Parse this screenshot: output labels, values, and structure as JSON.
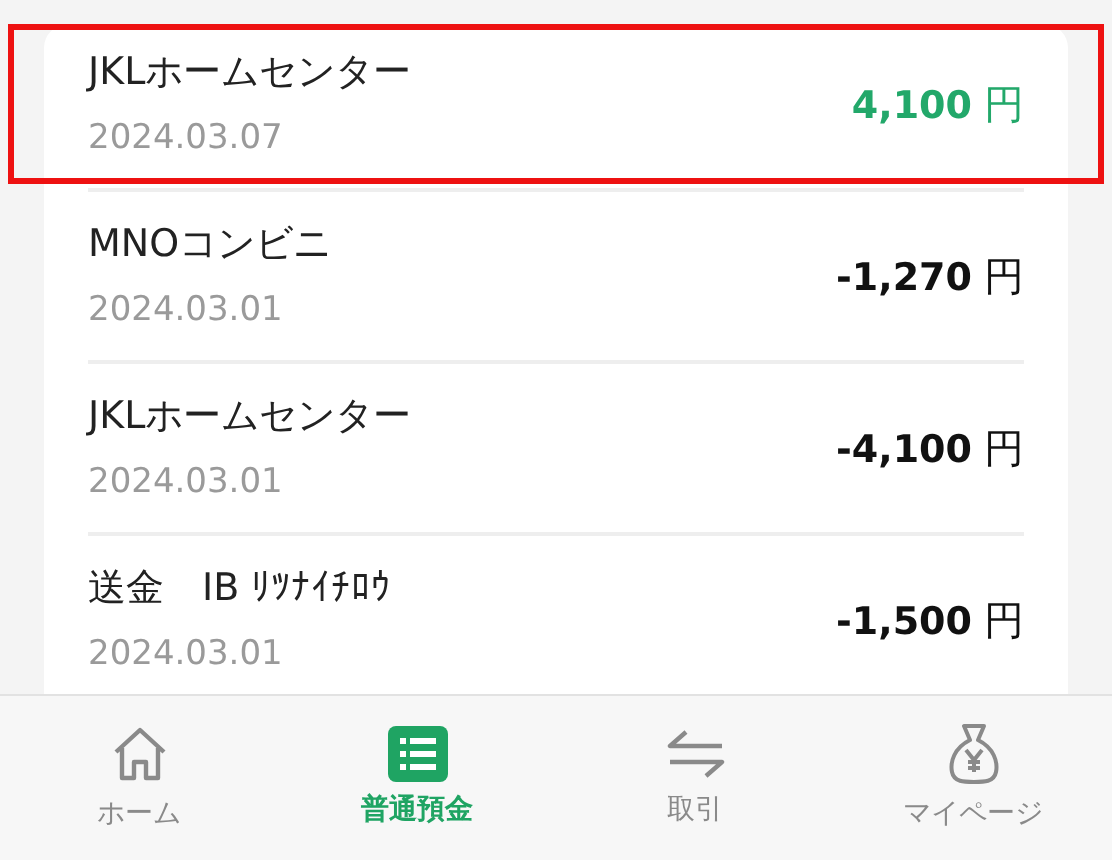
{
  "transactions": [
    {
      "name": "JKLホームセンター",
      "date": "2024.03.07",
      "amount": "4,100",
      "unit": "円",
      "kind": "income",
      "highlighted": true
    },
    {
      "name": "MNOコンビニ",
      "date": "2024.03.01",
      "amount": "-1,270",
      "unit": "円",
      "kind": "expense",
      "highlighted": false
    },
    {
      "name": "JKLホームセンター",
      "date": "2024.03.01",
      "amount": "-4,100",
      "unit": "円",
      "kind": "expense",
      "highlighted": false
    },
    {
      "name": "送金　IB ﾘﾂﾅｲﾁﾛｳ",
      "date": "2024.03.01",
      "amount": "-1,500",
      "unit": "円",
      "kind": "expense",
      "highlighted": false
    }
  ],
  "nav": [
    {
      "label": "ホーム",
      "kind": "home",
      "selected": false
    },
    {
      "label": "普通預金",
      "kind": "list",
      "selected": true
    },
    {
      "label": "取引",
      "kind": "transfer",
      "selected": false
    },
    {
      "label": "マイページ",
      "kind": "bag",
      "selected": false
    }
  ]
}
